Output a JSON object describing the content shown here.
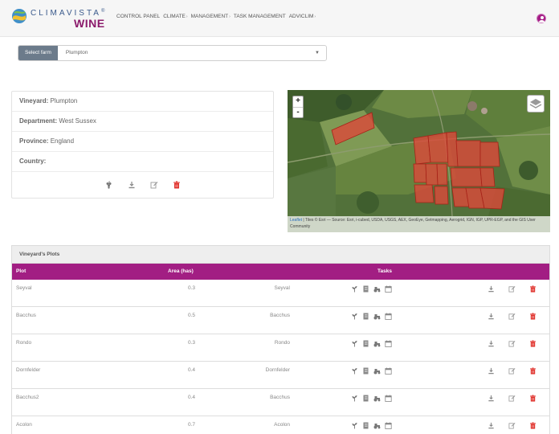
{
  "header": {
    "logo_top": "CLIMAVISTA",
    "logo_reg": "®",
    "logo_bottom": "WINE",
    "nav": [
      {
        "label": "CONTROL PANEL",
        "has_caret": false
      },
      {
        "label": "CLIMATE",
        "has_caret": true
      },
      {
        "label": "MANAGEMENT",
        "has_caret": true
      },
      {
        "label": "TASK MANAGEMENT",
        "has_caret": false
      },
      {
        "label": "ADVICLIM",
        "has_caret": true
      }
    ],
    "user_icon": "user-circle-icon"
  },
  "farm_select": {
    "label": "Select farm",
    "value": "Plumpton"
  },
  "vineyard": {
    "rows": [
      {
        "key": "Vineyard:",
        "value": "Plumpton"
      },
      {
        "key": "Department:",
        "value": "West Sussex"
      },
      {
        "key": "Province:",
        "value": "England"
      },
      {
        "key": "Country:",
        "value": ""
      }
    ],
    "actions": [
      "grape-icon",
      "download-icon",
      "edit-icon",
      "delete-icon"
    ]
  },
  "map": {
    "zoom_in": "+",
    "zoom_out": "-",
    "attribution_link": "Leaflet",
    "attribution_text": " | Tiles © Esri — Source: Esri, i-cubed, USDA, USGS, AEX, GeoEye, Getmapping, Aerogrid, IGN, IGP, UPR-EGP, and the GIS User Community"
  },
  "plots": {
    "title": "Vineyard's Plots",
    "columns": {
      "plot": "Plot",
      "area": "Area (has)",
      "tasks": "Tasks"
    },
    "rows": [
      {
        "plot": "Seyval",
        "area": "0.3",
        "variety": "Seyval"
      },
      {
        "plot": "Bacchus",
        "area": "0.5",
        "variety": "Bacchus"
      },
      {
        "plot": "Rondo",
        "area": "0.3",
        "variety": "Rondo"
      },
      {
        "plot": "Dornfelder",
        "area": "0.4",
        "variety": "Dornfelder"
      },
      {
        "plot": "Bacchus2",
        "area": "0.4",
        "variety": "Bacchus"
      },
      {
        "plot": "Acolon",
        "area": "0.7",
        "variety": "Acolon"
      }
    ],
    "task_icons": [
      "sprout-icon",
      "notebook-icon",
      "tractor-icon",
      "calendar-icon"
    ],
    "row_action_icons": [
      "download-icon",
      "edit-icon",
      "delete-icon"
    ]
  },
  "colors": {
    "accent": "#a21e83",
    "delete": "#e0312b",
    "plot_fill": "#d94a3b",
    "select_label_bg": "#6c7b8b"
  }
}
